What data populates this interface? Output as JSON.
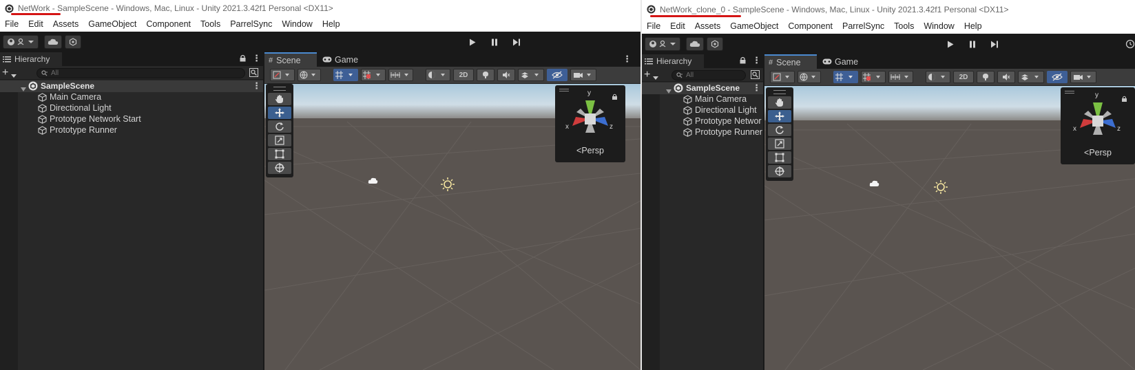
{
  "left": {
    "title": "NetWork - SampleScene - Windows, Mac, Linux - Unity 2021.3.42f1 Personal <DX11>",
    "menu": [
      "File",
      "Edit",
      "Assets",
      "GameObject",
      "Component",
      "Tools",
      "ParrelSync",
      "Window",
      "Help"
    ],
    "hierarchy_tab": "Hierarchy",
    "search_placeholder": "All",
    "scene_name": "SampleScene",
    "objects": [
      "Main Camera",
      "Directional Light",
      "Prototype Network Start",
      "Prototype Runner"
    ],
    "tabs": {
      "scene": "Scene",
      "game": "Game"
    },
    "btn_2d": "2D",
    "persp": "Persp",
    "axes": {
      "x": "x",
      "y": "y",
      "z": "z"
    }
  },
  "right": {
    "title": "NetWork_clone_0 - SampleScene - Windows, Mac, Linux - Unity 2021.3.42f1 Personal <DX11>",
    "menu": [
      "File",
      "Edit",
      "Assets",
      "GameObject",
      "Component",
      "ParrelSync",
      "Tools",
      "Window",
      "Help"
    ],
    "hierarchy_tab": "Hierarchy",
    "search_placeholder": "All",
    "scene_name": "SampleScene",
    "objects": [
      "Main Camera",
      "Directional Light",
      "Prototype Networ",
      "Prototype Runner"
    ],
    "tabs": {
      "scene": "Scene",
      "game": "Game"
    },
    "btn_2d": "2D",
    "persp": "Persp",
    "axes": {
      "x": "x",
      "y": "y",
      "z": "z"
    }
  },
  "colors": {
    "highlight_underline": "#d41414",
    "active_tool": "#3b5f8f",
    "sky_top": "#b8d4e6",
    "ground": "#5a5450"
  }
}
